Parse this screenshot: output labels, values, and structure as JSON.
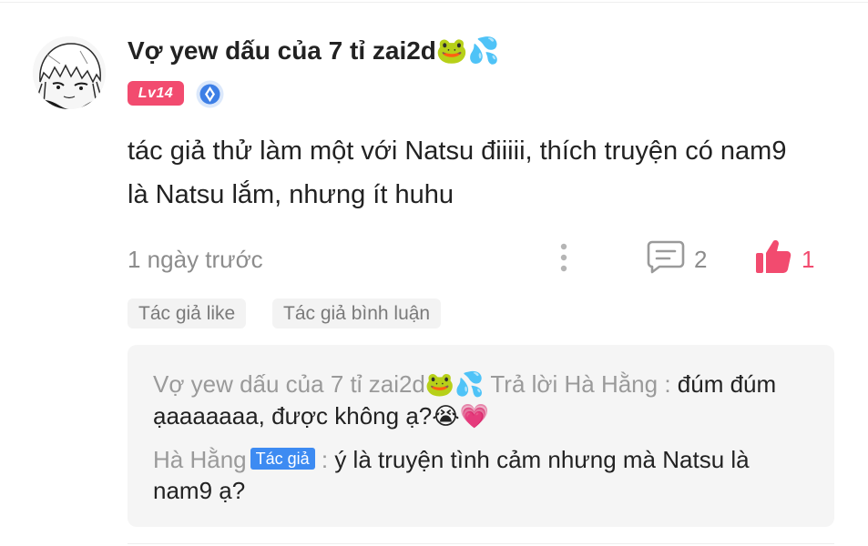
{
  "comment": {
    "user": {
      "name": "Vợ yew dấu của 7 tỉ zai2d",
      "name_emoji": "🐸💦",
      "level": "Lv14",
      "avatar": "anime-avatar-icon",
      "verified_icon": "vip-badge-icon"
    },
    "text": "tác giả thử làm một với Natsu điiiii, thích truyện có nam9 là Natsu lắm, nhưng ít huhu",
    "timestamp": "1 ngày trước",
    "more_icon": "more-vertical-icon",
    "reply_icon": "comment-icon",
    "reply_count": "2",
    "like_icon": "thumbs-up-icon",
    "like_count": "1",
    "tags": [
      "Tác giả like",
      "Tác giả bình luận"
    ]
  },
  "replies": [
    {
      "author": "Vợ yew dấu của 7 tỉ zai2d",
      "author_emoji": "🐸💦",
      "verb": " Trả lời Hà Hằng",
      "separator": " : ",
      "text": "đúm đúm ạaaaaaaa, được không ạ?",
      "text_emoji": "😭💗"
    },
    {
      "author": "Hà Hằng",
      "author_tag": "Tác giả",
      "separator": " : ",
      "text": "ý là truyện tình cảm nhưng mà Natsu là nam9 ạ?"
    }
  ],
  "colors": {
    "accent_pink": "#f24b6f",
    "author_blue": "#3d8bf2",
    "muted_text": "#8c8c8c",
    "reply_bg": "#f5f5f5",
    "tag_bg": "#f3f3f3"
  }
}
